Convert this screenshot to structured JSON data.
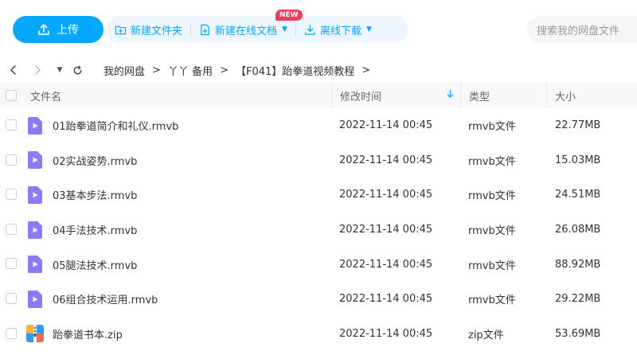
{
  "toolbar": {
    "upload_label": "上传",
    "new_folder_label": "新建文件夹",
    "new_doc_label": "新建在线文档",
    "new_badge": "NEW",
    "offline_download_label": "离线下载",
    "search_placeholder": "搜索我的网盘文件"
  },
  "breadcrumb": {
    "items": [
      "我的网盘",
      "丫丫 备用",
      "【F041】跆拳道视频教程"
    ],
    "separator": ">"
  },
  "table": {
    "headers": {
      "name": "文件名",
      "time": "修改时间",
      "type": "类型",
      "size": "大小"
    },
    "rows": [
      {
        "name": "01跆拳道简介和礼仪.rmvb",
        "time": "2022-11-14 00:45",
        "type": "rmvb文件",
        "size": "22.77MB",
        "icon": "video-file-icon"
      },
      {
        "name": "02实战姿势.rmvb",
        "time": "2022-11-14 00:45",
        "type": "rmvb文件",
        "size": "15.03MB",
        "icon": "video-file-icon"
      },
      {
        "name": "03基本步法.rmvb",
        "time": "2022-11-14 00:45",
        "type": "rmvb文件",
        "size": "24.51MB",
        "icon": "video-file-icon"
      },
      {
        "name": "04手法技术.rmvb",
        "time": "2022-11-14 00:45",
        "type": "rmvb文件",
        "size": "26.08MB",
        "icon": "video-file-icon"
      },
      {
        "name": "05腿法技术.rmvb",
        "time": "2022-11-14 00:45",
        "type": "rmvb文件",
        "size": "88.92MB",
        "icon": "video-file-icon"
      },
      {
        "name": "06组合技术运用.rmvb",
        "time": "2022-11-14 00:45",
        "type": "rmvb文件",
        "size": "29.22MB",
        "icon": "video-file-icon"
      },
      {
        "name": "跆拳道书本.zip",
        "time": "2022-11-14 00:45",
        "type": "zip文件",
        "size": "53.69MB",
        "icon": "zip-file-icon"
      }
    ]
  },
  "colors": {
    "accent": "#06a7ff",
    "video_icon": "#8b7cf6",
    "badge": "#f33c5a"
  }
}
